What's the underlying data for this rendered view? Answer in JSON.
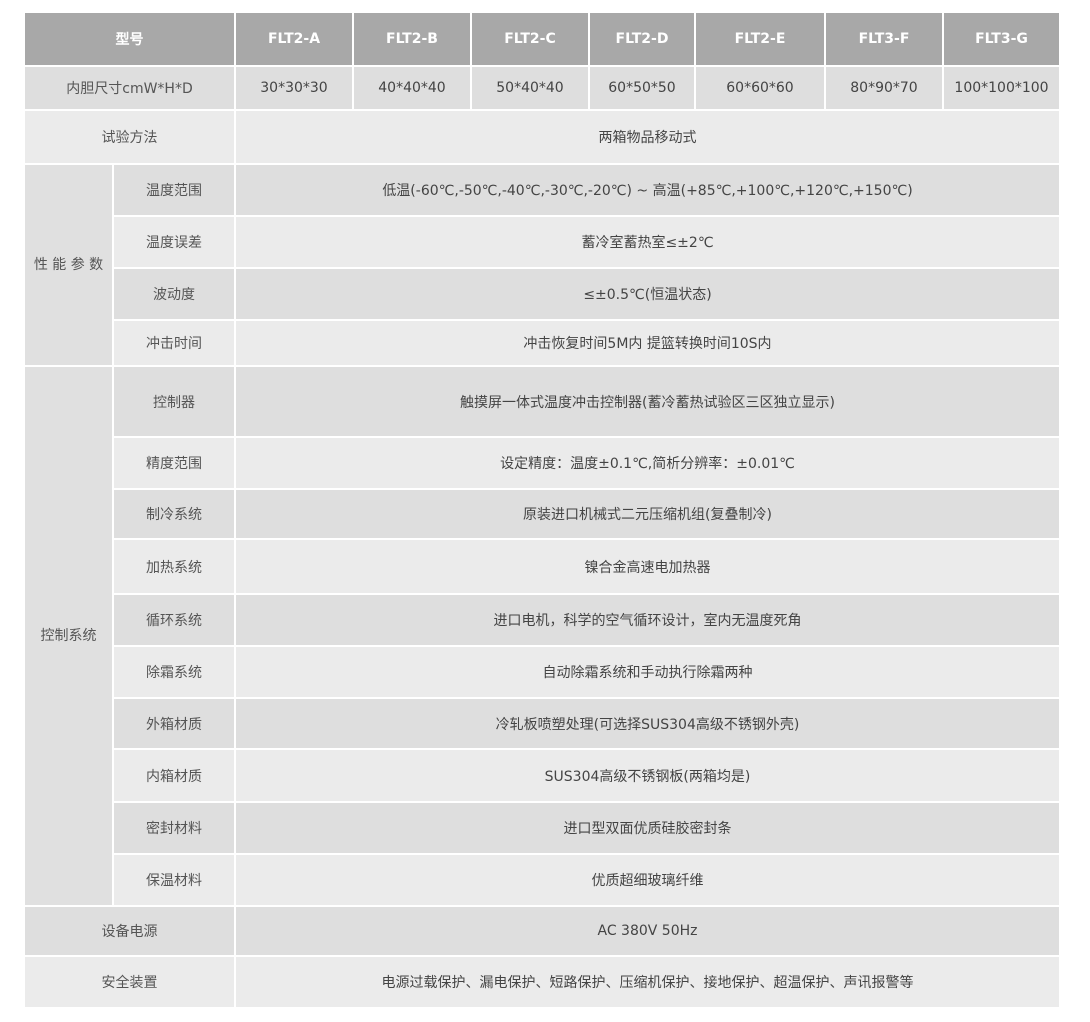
{
  "header": {
    "model_label": "型号",
    "models": [
      "FLT2-A",
      "FLT2-B",
      "FLT2-C",
      "FLT2-D",
      "FLT2-E",
      "FLT3-F",
      "FLT3-G"
    ]
  },
  "inner_size": {
    "label": "内胆尺寸cmW*H*D",
    "values": [
      "30*30*30",
      "40*40*40",
      "50*40*40",
      "60*50*50",
      "60*60*60",
      "80*90*70",
      "100*100*100"
    ]
  },
  "test_method": {
    "label": "试验方法",
    "value": "两箱物品移动式"
  },
  "performance": {
    "group_label": "性 能 参 数",
    "rows": [
      {
        "label": "温度范围",
        "value": "低温(-60℃,-50℃,-40℃,-30℃,-20℃) ~ 高温(+85℃,+100℃,+120℃,+150℃)"
      },
      {
        "label": "温度误差",
        "value": "蓄冷室蓄热室≤±2℃"
      },
      {
        "label": "波动度",
        "value": "≤±0.5℃(恒温状态)"
      },
      {
        "label": "冲击时间",
        "value": "冲击恢复时间5M内 提篮转换时间10S内"
      }
    ]
  },
  "control": {
    "group_label": "控制系统",
    "rows": [
      {
        "label": "控制器",
        "value": "触摸屏一体式温度冲击控制器(蓄冷蓄热试验区三区独立显示)"
      },
      {
        "label": "精度范围",
        "value": "设定精度：温度±0.1℃,简析分辨率：±0.01℃"
      },
      {
        "label": "制冷系统",
        "value": "原装进口机械式二元压缩机组(复叠制冷)"
      },
      {
        "label": "加热系统",
        "value": "镍合金高速电加热器"
      },
      {
        "label": "循环系统",
        "value": "进口电机，科学的空气循环设计，室内无温度死角"
      },
      {
        "label": "除霜系统",
        "value": "自动除霜系统和手动执行除霜两种"
      },
      {
        "label": "外箱材质",
        "value": "冷轧板喷塑处理(可选择SUS304高级不锈钢外壳)"
      },
      {
        "label": "内箱材质",
        "value": "SUS304高级不锈钢板(两箱均是)"
      },
      {
        "label": "密封材料",
        "value": "进口型双面优质硅胶密封条"
      },
      {
        "label": "保温材料",
        "value": "优质超细玻璃纤维"
      }
    ]
  },
  "power": {
    "label": "设备电源",
    "value": "AC  380V  50Hz"
  },
  "safety": {
    "label": "安全装置",
    "value": "电源过载保护、漏电保护、短路保护、压缩机保护、接地保护、超温保护、声讯报警等"
  }
}
